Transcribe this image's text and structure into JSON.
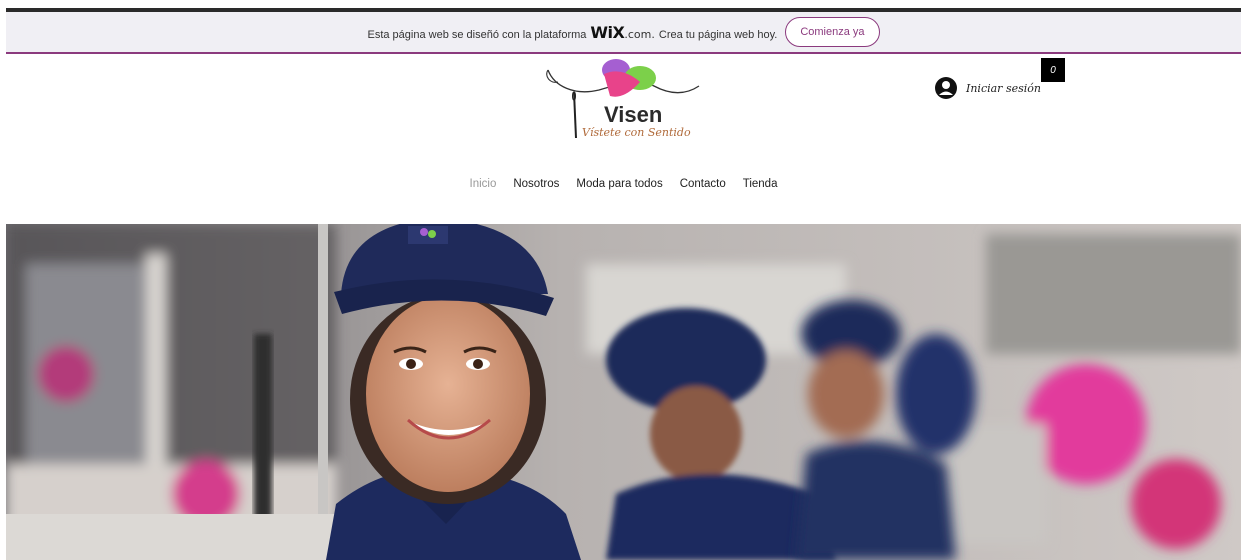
{
  "wix_banner": {
    "text_before": "Esta página web se diseñó con la plataforma",
    "brand": "WiX",
    "brand_suffix": ".com.",
    "text_after": "Crea tu página web hoy.",
    "cta_label": "Comienza ya"
  },
  "logo": {
    "title": "Visen",
    "tagline": "Vístete con Sentido"
  },
  "header": {
    "login_label": "Iniciar sesión",
    "cart_count": "0"
  },
  "nav": {
    "items": [
      {
        "label": "Inicio"
      },
      {
        "label": "Nosotros"
      },
      {
        "label": "Moda para todos"
      },
      {
        "label": "Contacto"
      },
      {
        "label": "Tienda"
      }
    ]
  },
  "hero": {
    "image": "photo of smiling textile factory workers in navy caps"
  },
  "colors": {
    "accent": "#8b3a7e",
    "banner_bg": "#f0eff4",
    "navy": "#1f2a5a"
  }
}
